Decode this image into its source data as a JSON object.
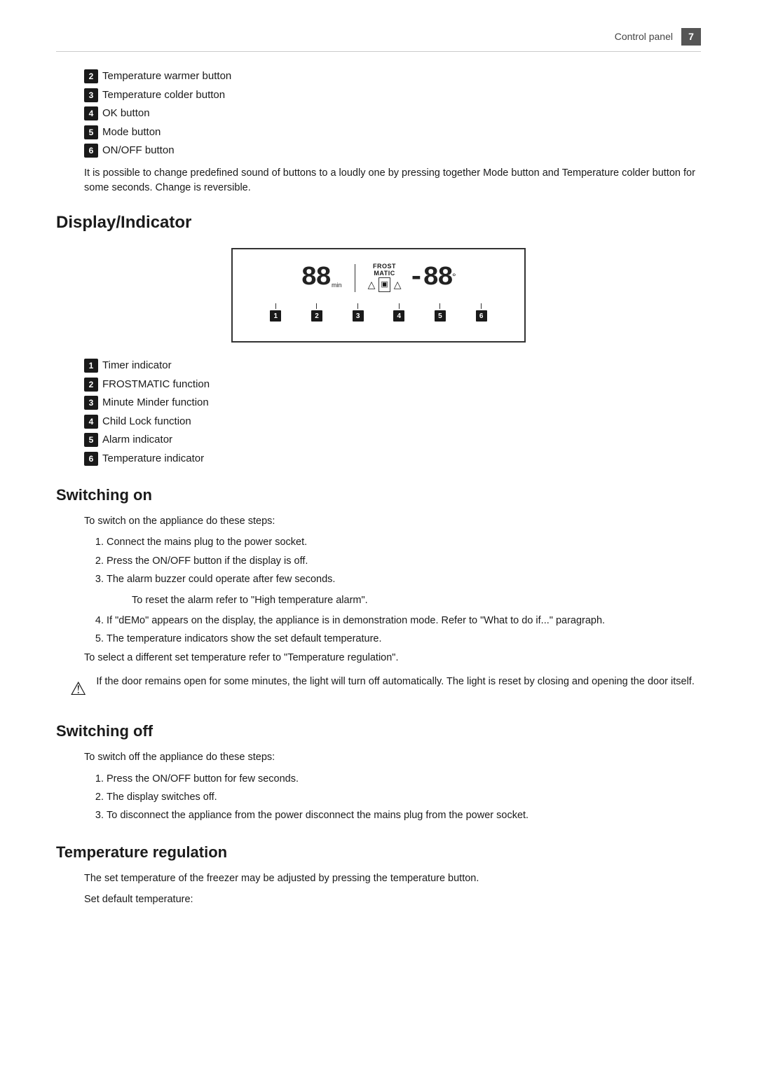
{
  "header": {
    "label": "Control panel",
    "page_number": "7"
  },
  "button_items": [
    {
      "num": "2",
      "text": "Temperature warmer button"
    },
    {
      "num": "3",
      "text": "Temperature colder button"
    },
    {
      "num": "4",
      "text": "OK button"
    },
    {
      "num": "5",
      "text": "Mode button"
    },
    {
      "num": "6",
      "text": "ON/OFF button"
    }
  ],
  "intro_note": "It is possible to change predefined sound of buttons to a loudly one by pressing together Mode button and Temperature colder button for some seconds. Change is reversible.",
  "display_section": {
    "title": "Display/Indicator",
    "diagram": {
      "left_seg": "88",
      "min_label": "min",
      "frost_matic": "FROST\nMATIC",
      "icons": "△ ▣ △",
      "right_seg": "-88",
      "degree": "°",
      "markers": [
        "1",
        "2",
        "3",
        "4",
        "5",
        "6"
      ]
    },
    "indicators": [
      {
        "num": "1",
        "text": "Timer indicator"
      },
      {
        "num": "2",
        "text": "FROSTMATIC function"
      },
      {
        "num": "3",
        "text": "Minute Minder function"
      },
      {
        "num": "4",
        "text": "Child Lock function"
      },
      {
        "num": "5",
        "text": "Alarm indicator"
      },
      {
        "num": "6",
        "text": "Temperature indicator"
      }
    ]
  },
  "switching_on": {
    "title": "Switching on",
    "intro": "To switch on the appliance do these steps:",
    "steps": [
      "Connect the mains plug to the power socket.",
      "Press the ON/OFF button if the display is off.",
      "The alarm buzzer could operate after few seconds."
    ],
    "step3_note": "To reset the alarm refer to \"High temperature alarm\".",
    "step4": "If \"dEMo\" appears on the display, the appliance is in demonstration mode. Refer to \"What to do if...\" paragraph.",
    "step5": "The temperature indicators show the set default temperature.",
    "step5_note": "To select a different set temperature refer to \"Temperature regulation\".",
    "warning": "If the door remains open for some minutes, the light will turn off automatically. The light is reset by closing and opening the door itself."
  },
  "switching_off": {
    "title": "Switching off",
    "intro": "To switch off the appliance do these steps:",
    "steps": [
      "Press the ON/OFF button for few seconds.",
      "The display switches off.",
      "To disconnect the appliance from the power disconnect the mains plug from the power socket."
    ]
  },
  "temperature_regulation": {
    "title": "Temperature regulation",
    "text": "The set temperature of the freezer may be adjusted by pressing the temperature button.",
    "text2": "Set default temperature:"
  }
}
